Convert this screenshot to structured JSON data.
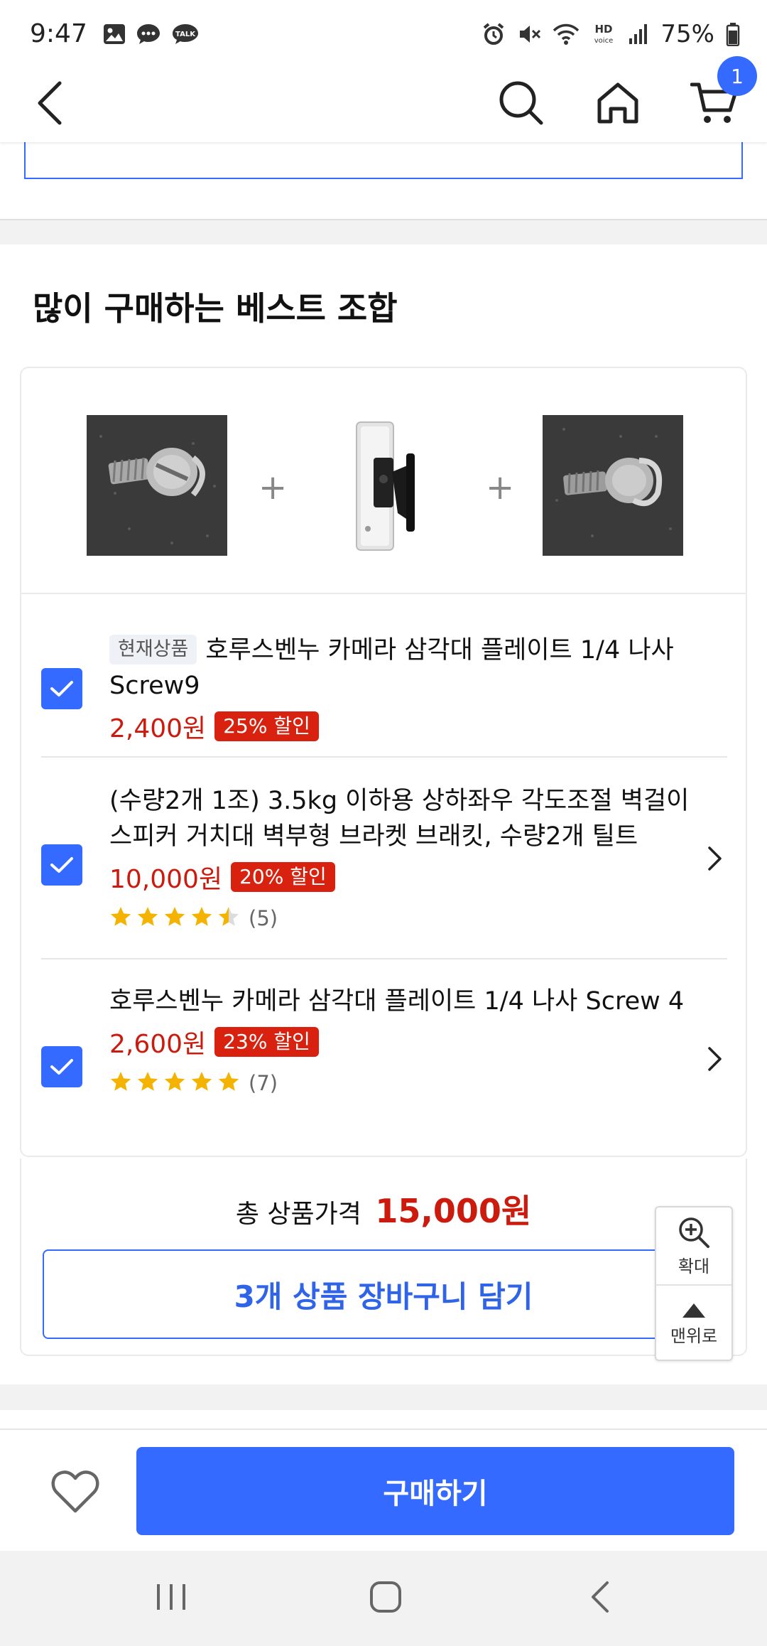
{
  "status_bar": {
    "time": "9:47",
    "battery": "75%",
    "left_icons": [
      "gallery-icon",
      "chat-icon",
      "talk-icon"
    ],
    "right_icons": [
      "alarm-icon",
      "mute-icon",
      "wifi-icon",
      "hd-voice-icon",
      "signal-icon",
      "battery-icon"
    ]
  },
  "header": {
    "cart_count": "1"
  },
  "section": {
    "title": "많이 구매하는 베스트 조합"
  },
  "combo": {
    "items": [
      {
        "tag": "현재상품",
        "name": "호루스벤누 카메라 삼각대 플레이트 1/4 나사 Screw9",
        "price": "2,400원",
        "discount": "25% 할인",
        "checked": true
      },
      {
        "name": "(수량2개 1조) 3.5kg 이하용 상하좌우 각도조절 벽걸이 스피커 거치대 벽부형 브라켓 브래킷, 수량2개 틸트",
        "price": "10,000원",
        "discount": "20% 할인",
        "rating": 4.5,
        "review_count": "(5)",
        "checked": true
      },
      {
        "name": "호루스벤누 카메라 삼각대 플레이트 1/4 나사 Screw 4",
        "price": "2,600원",
        "discount": "23% 할인",
        "rating": 5,
        "review_count": "(7)",
        "checked": true
      }
    ],
    "total_label": "총 상품가격",
    "total_price": "15,000원",
    "add_to_cart_label": "3개 상품 장바구니 담기"
  },
  "float_panel": {
    "zoom_label": "확대",
    "top_label": "맨위로"
  },
  "bottom_bar": {
    "buy_label": "구매하기"
  },
  "colors": {
    "accent": "#346aff",
    "price": "#cc1b0e",
    "discount_bg": "#d8220f",
    "star": "#f5b301"
  }
}
